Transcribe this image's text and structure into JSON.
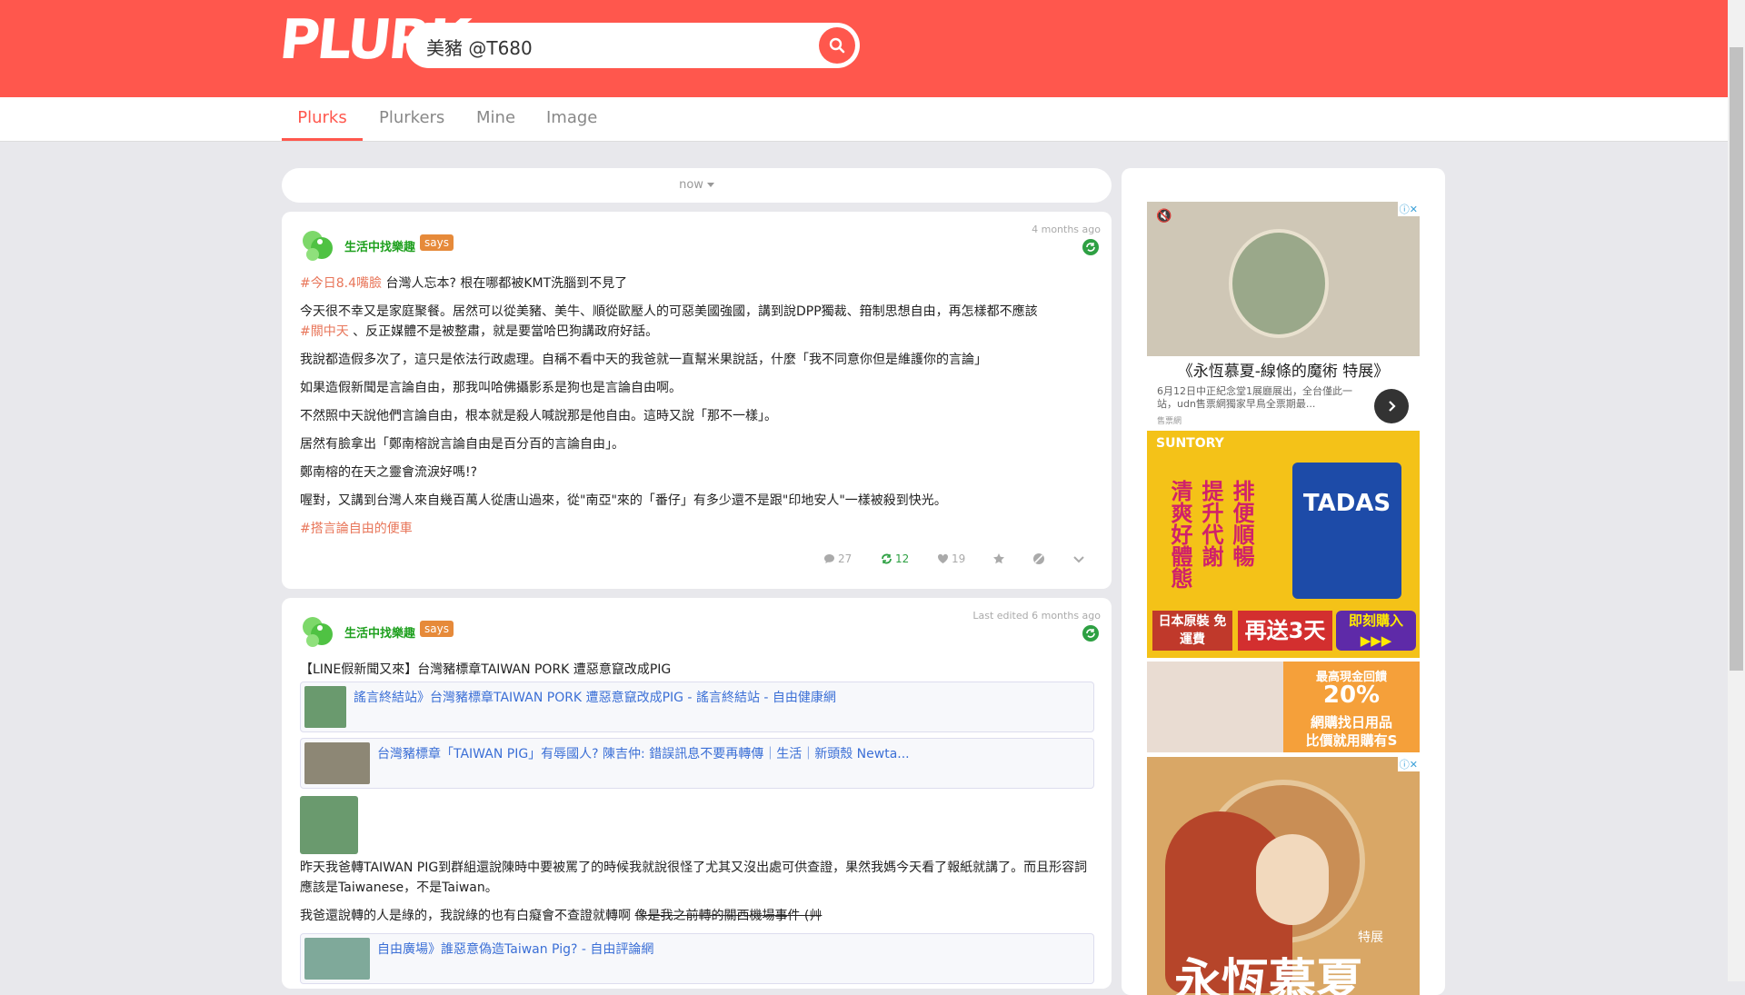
{
  "header": {
    "logo": "PLURK",
    "search_value": "美豬 @T680",
    "brand_color": "#ff574d"
  },
  "tabs": [
    {
      "label": "Plurks",
      "active": true
    },
    {
      "label": "Plurkers",
      "active": false
    },
    {
      "label": "Mine",
      "active": false
    },
    {
      "label": "Image",
      "active": false
    }
  ],
  "time_filter": "now",
  "plurks": [
    {
      "user": "生活中找樂趣",
      "says": "says",
      "time": "4 months ago",
      "lines": {
        "l1_tag": "#今日8.4嘴臉",
        "l1_text": " 台灣人忘本? 根在哪都被KMT洗腦到不見了",
        "l2_text": "今天很不幸又是家庭聚餐。居然可以從美豬、美牛、順從歐壓人的可惡美國強國，講到說DPP獨裁、箝制思想自由，再怎樣都不應該",
        "l2_tag": "#關中天",
        "l2_rest": " 、反正媒體不是被整肅，就是要當哈巴狗講政府好話。",
        "l3": "我說都造假多次了，這只是依法行政處理。自稱不看中天的我爸就一直幫米果說話，什麼「我不同意你但是維護你的言論」",
        "l4": "如果造假新聞是言論自由，那我叫哈佛攝影系是狗也是言論自由啊。",
        "l5": "不然照中天說他們言論自由，根本就是殺人喊說那是他自由。這時又說「那不一樣」。",
        "l6": "居然有臉拿出「鄭南榕說言論自由是百分百的言論自由」。",
        "l7": "鄭南榕的在天之靈會流淚好嗎!?",
        "l8": "喔對，又講到台灣人來自幾百萬人從唐山過來，從\"南亞\"來的「番仔」有多少還不是跟\"印地安人\"一樣被殺到快光。",
        "l9_tag": "#搭言論自由的便車"
      },
      "actions": {
        "responses": "27",
        "replurks": "12",
        "likes": "19"
      }
    },
    {
      "user": "生活中找樂趣",
      "says": "says",
      "time": "Last edited 6 months ago",
      "intro": "【LINE假新聞又來】台灣豬標章TAIWAN PORK 遭惡意竄改成PIG",
      "link1": "謠言終結站》台灣豬標章TAIWAN PORK 遭惡意竄改成PIG - 謠言終結站 - 自由健康網",
      "link2": "台灣豬標章「TAIWAN PIG」有辱國人? 陳吉仲: 錯誤訊息不要再轉傳｜生活｜新頭殼 Newta...",
      "para1": "昨天我爸轉TAIWAN PIG到群組還說陳時中要被罵了的時候我就說很怪了尤其又沒出處可供查證，果然我媽今天看了報紙就講了。而且形容詞應該是Taiwanese，不是Taiwan。",
      "para2_normal": "我爸還說轉的人是綠的，我說綠的也有白癡會不查證就轉啊 ",
      "para2_strike": "像是我之前轉的關西機場事件 (艸",
      "link3": "自由廣場》誰惡意偽造Taiwan Pig? - 自由評論網"
    }
  ],
  "sidebar": {
    "ad1_title": "《永恆慕夏-線條的魔術 特展》",
    "ad1_desc": "6月12日中正紀念堂1展廳展出，全台僅此一站，udn售票網獨家早鳥全票期最...",
    "ad1_source": "售票網",
    "ad2_brand": "SUNTORY",
    "ad2_line1": "清爽好體態",
    "ad2_line2": "提升代謝",
    "ad2_line3": "排便順暢",
    "ad2_product": "TADAS",
    "ad2_btn1": "日本原裝 免運費",
    "ad2_btn2": "再送3天份",
    "ad2_btn3": "即刻購入 ▶▶▶",
    "ad3_line1": "最高現金回饋",
    "ad3_line2": "20%",
    "ad3_line3": "網購找日用品",
    "ad3_line4": "比價就用購有S",
    "ad4_big": "永恆慕夏",
    "ad4_small": "特展"
  }
}
